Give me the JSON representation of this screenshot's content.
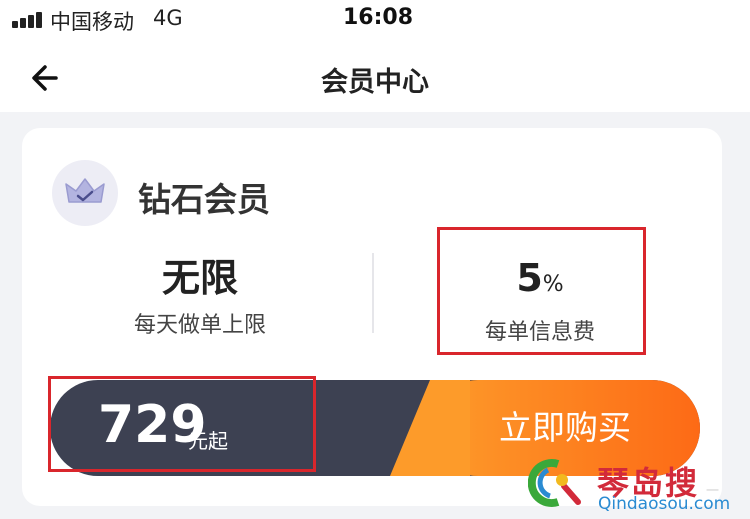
{
  "status_bar": {
    "carrier": "中国移动",
    "network": "4G",
    "time": "16:08"
  },
  "header": {
    "title": "会员中心"
  },
  "membership": {
    "tier_name": "钻石会员",
    "benefits": [
      {
        "value": "无限",
        "unit": "",
        "label": "每天做单上限"
      },
      {
        "value": "5",
        "unit": "%",
        "label": "每单信息费"
      }
    ],
    "price": "729",
    "price_suffix": "元起",
    "buy_label": "立即购买"
  },
  "watermark": {
    "main": "琴岛搜",
    "sub": "Qindaosou.com",
    "tail": "一"
  },
  "colors": {
    "accent_orange": "#fd7e1f",
    "price_bar": "#3d4152",
    "highlight": "#d9262c"
  },
  "icons": {
    "back": "arrow-left-icon",
    "tier": "crown-icon",
    "signal": "signal-icon",
    "watermark": "watermark-logo-icon"
  }
}
